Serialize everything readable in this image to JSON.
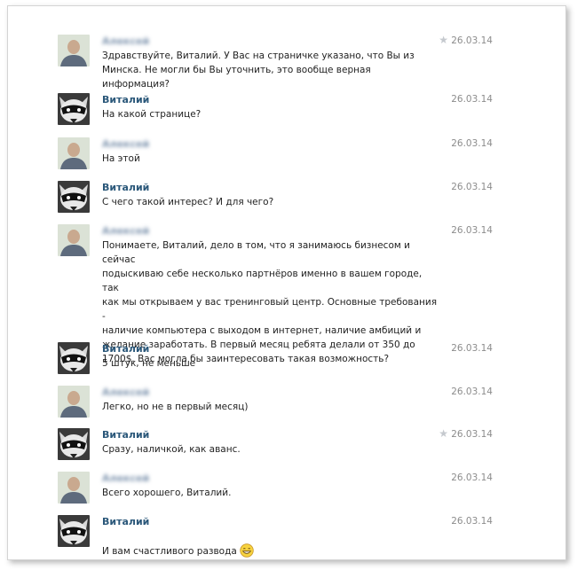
{
  "participants": {
    "other": {
      "name": "Алексей"
    },
    "vitaly": {
      "name": "Виталий"
    }
  },
  "messages": [
    {
      "author": "Алексей",
      "date": "26.03.14",
      "starred": true,
      "text": "Здравствуйте, Виталий. У Вас на страничке указано, что Вы из\nМинска. Не могли бы Вы уточнить, это вообще верная информация?"
    },
    {
      "author": "Виталий",
      "date": "26.03.14",
      "starred": false,
      "text": "На какой странице?"
    },
    {
      "author": "Алексей",
      "date": "26.03.14",
      "starred": false,
      "text": "На этой"
    },
    {
      "author": "Виталий",
      "date": "26.03.14",
      "starred": false,
      "text": "С чего такой интерес? И для чего?"
    },
    {
      "author": "Алексей",
      "date": "26.03.14",
      "starred": false,
      "text": "Понимаете, Виталий, дело в том, что я занимаюсь бизнесом и сейчас\nподыскиваю себе несколько партнёров именно в вашем городе, так\nкак мы открываем у вас тренинговый центр. Основные требования -\nналичие компьютера с выходом в интернет, наличие амбиций и\nжелание заработать. В первый месяц ребята делали от 350 до\n1700$. Вас могла бы заинтересовать такая возможность?"
    },
    {
      "author": "Виталий",
      "date": "26.03.14",
      "starred": false,
      "text": "5 штук, не меньше"
    },
    {
      "author": "Алексей",
      "date": "26.03.14",
      "starred": false,
      "text": "Легко, но не в первый месяц)"
    },
    {
      "author": "Виталий",
      "date": "26.03.14",
      "starred": true,
      "text": "Сразу, наличкой, как аванс."
    },
    {
      "author": "Алексей",
      "date": "26.03.14",
      "starred": false,
      "text": "Всего хорошего, Виталий."
    },
    {
      "author": "Виталий",
      "date": "26.03.14",
      "starred": false,
      "text": "И вам счастливого развода",
      "emoji": "grinning-face-emoji"
    }
  ]
}
